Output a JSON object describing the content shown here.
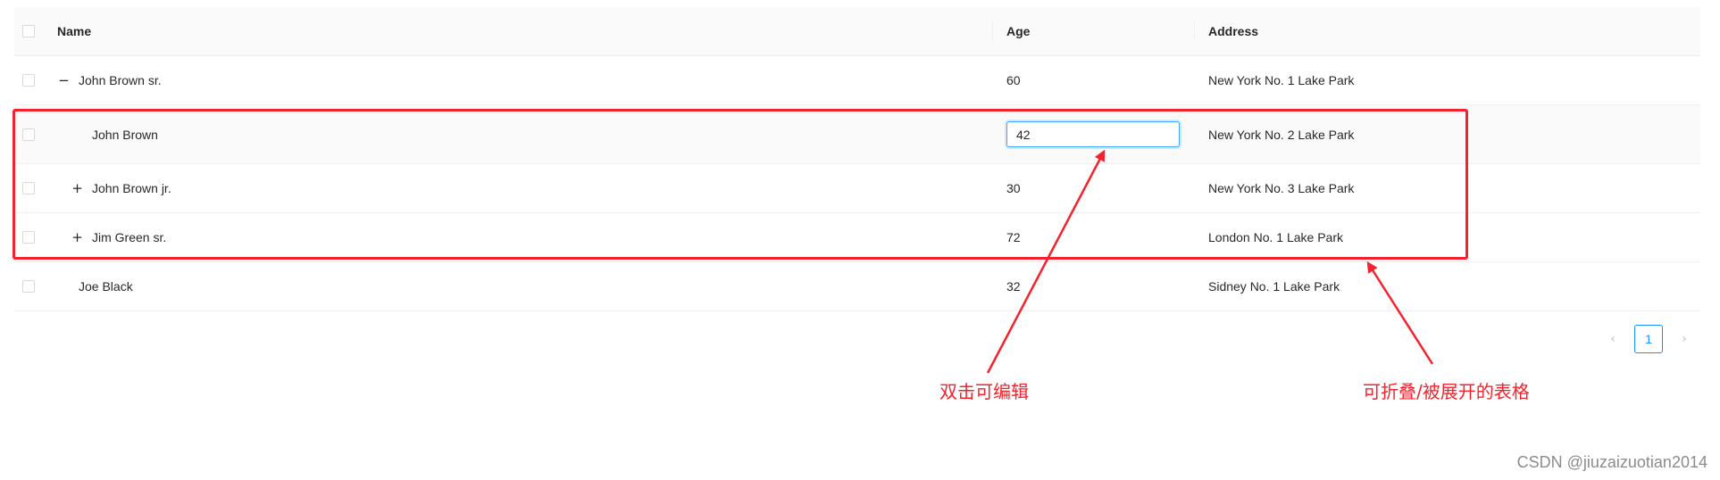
{
  "table": {
    "columns": {
      "name": "Name",
      "age": "Age",
      "address": "Address"
    },
    "rows": [
      {
        "name": "John Brown sr.",
        "age": "60",
        "address": "New York No. 1 Lake Park",
        "expander": "−"
      },
      {
        "name": "John Brown",
        "age": "42",
        "address": "New York No. 2 Lake Park",
        "expander": ""
      },
      {
        "name": "John Brown jr.",
        "age": "30",
        "address": "New York No. 3 Lake Park",
        "expander": "+"
      },
      {
        "name": "Jim Green sr.",
        "age": "72",
        "address": "London No. 1 Lake Park",
        "expander": "+"
      },
      {
        "name": "Joe Black",
        "age": "32",
        "address": "Sidney No. 1 Lake Park",
        "expander": ""
      }
    ]
  },
  "pagination": {
    "prev": "‹",
    "current": "1",
    "next": "›"
  },
  "annotations": {
    "edit_note": "双击可编辑",
    "collapse_note": "可折叠/被展开的表格",
    "color": "#f5222d"
  },
  "watermark": "CSDN @jiuzaizuotian2014"
}
